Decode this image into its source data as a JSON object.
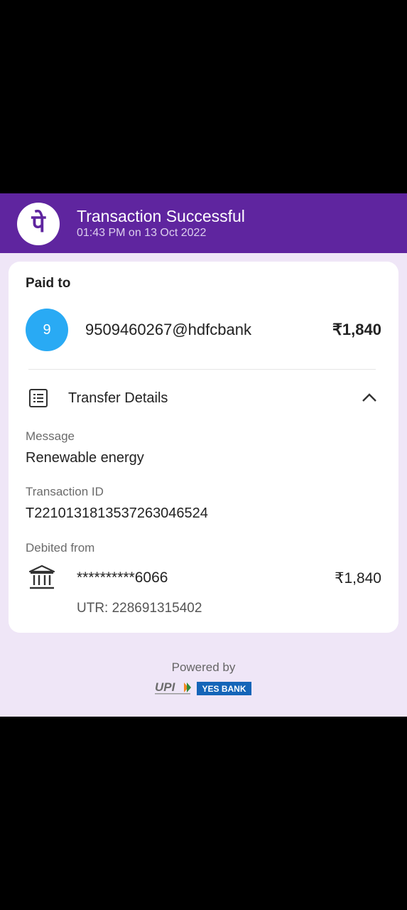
{
  "header": {
    "logo_glyph": "पे",
    "title": "Transaction Successful",
    "timestamp": "01:43 PM on 13 Oct 2022"
  },
  "payment": {
    "paid_to_label": "Paid to",
    "avatar_initial": "9",
    "payee_upi": "9509460267@hdfcbank",
    "amount": "₹1,840"
  },
  "transfer_details": {
    "section_label": "Transfer Details",
    "message_label": "Message",
    "message_value": "Renewable energy",
    "txn_id_label": "Transaction ID",
    "txn_id_value": "T2210131813537263046524",
    "debited_from_label": "Debited from",
    "account_masked": "**********6066",
    "debited_amount": "₹1,840",
    "utr": "UTR: 228691315402"
  },
  "footer": {
    "powered_by": "Powered by",
    "upi_text": "UPI",
    "bank_text": "YES BANK"
  },
  "colors": {
    "brand": "#5f259f",
    "avatar": "#29aaf4",
    "background": "#efe6f7"
  }
}
